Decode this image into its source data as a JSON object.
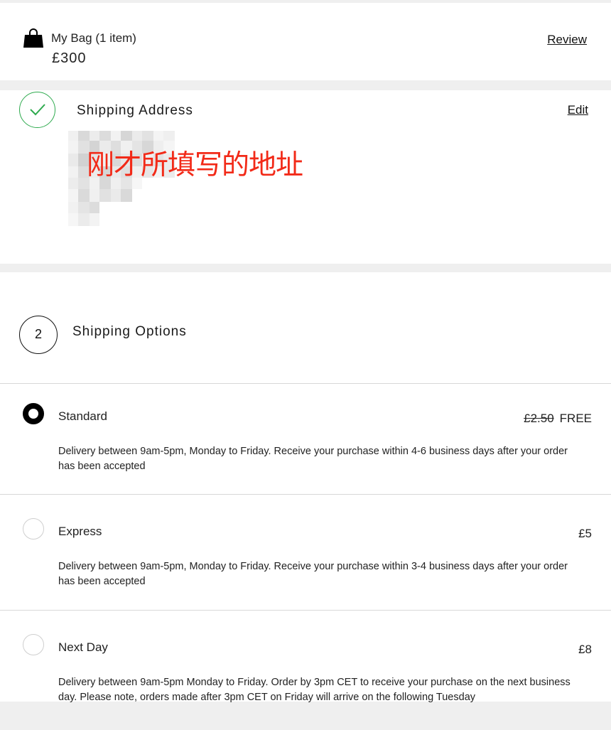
{
  "bag": {
    "icon": "shopping-bag-icon",
    "title": "My Bag (1 item)",
    "total": "£300",
    "review_label": "Review"
  },
  "address": {
    "title": "Shipping Address",
    "edit_label": "Edit",
    "status_icon": "checkmark-icon",
    "status_color": "#2eaa4e",
    "annotation": "刚才所填写的地址",
    "annotation_color": "#f22a18"
  },
  "options": {
    "step_number": "2",
    "title": "Shipping Options",
    "items": [
      {
        "name": "Standard",
        "old_price": "£2.50",
        "price": "FREE",
        "selected": true,
        "description": "Delivery between 9am-5pm, Monday to Friday. Receive your purchase within 4-6 business days after your order has been accepted"
      },
      {
        "name": "Express",
        "old_price": "",
        "price": "£5",
        "selected": false,
        "description": "Delivery between 9am-5pm, Monday to Friday. Receive your purchase within 3-4 business days after your order has been accepted"
      },
      {
        "name": "Next Day",
        "old_price": "",
        "price": "£8",
        "selected": false,
        "description": "Delivery between 9am-5pm Monday to Friday. Order by 3pm CET to receive your purchase on the next business day. Please note, orders made after 3pm CET on Friday will arrive on the following Tuesday"
      }
    ]
  }
}
